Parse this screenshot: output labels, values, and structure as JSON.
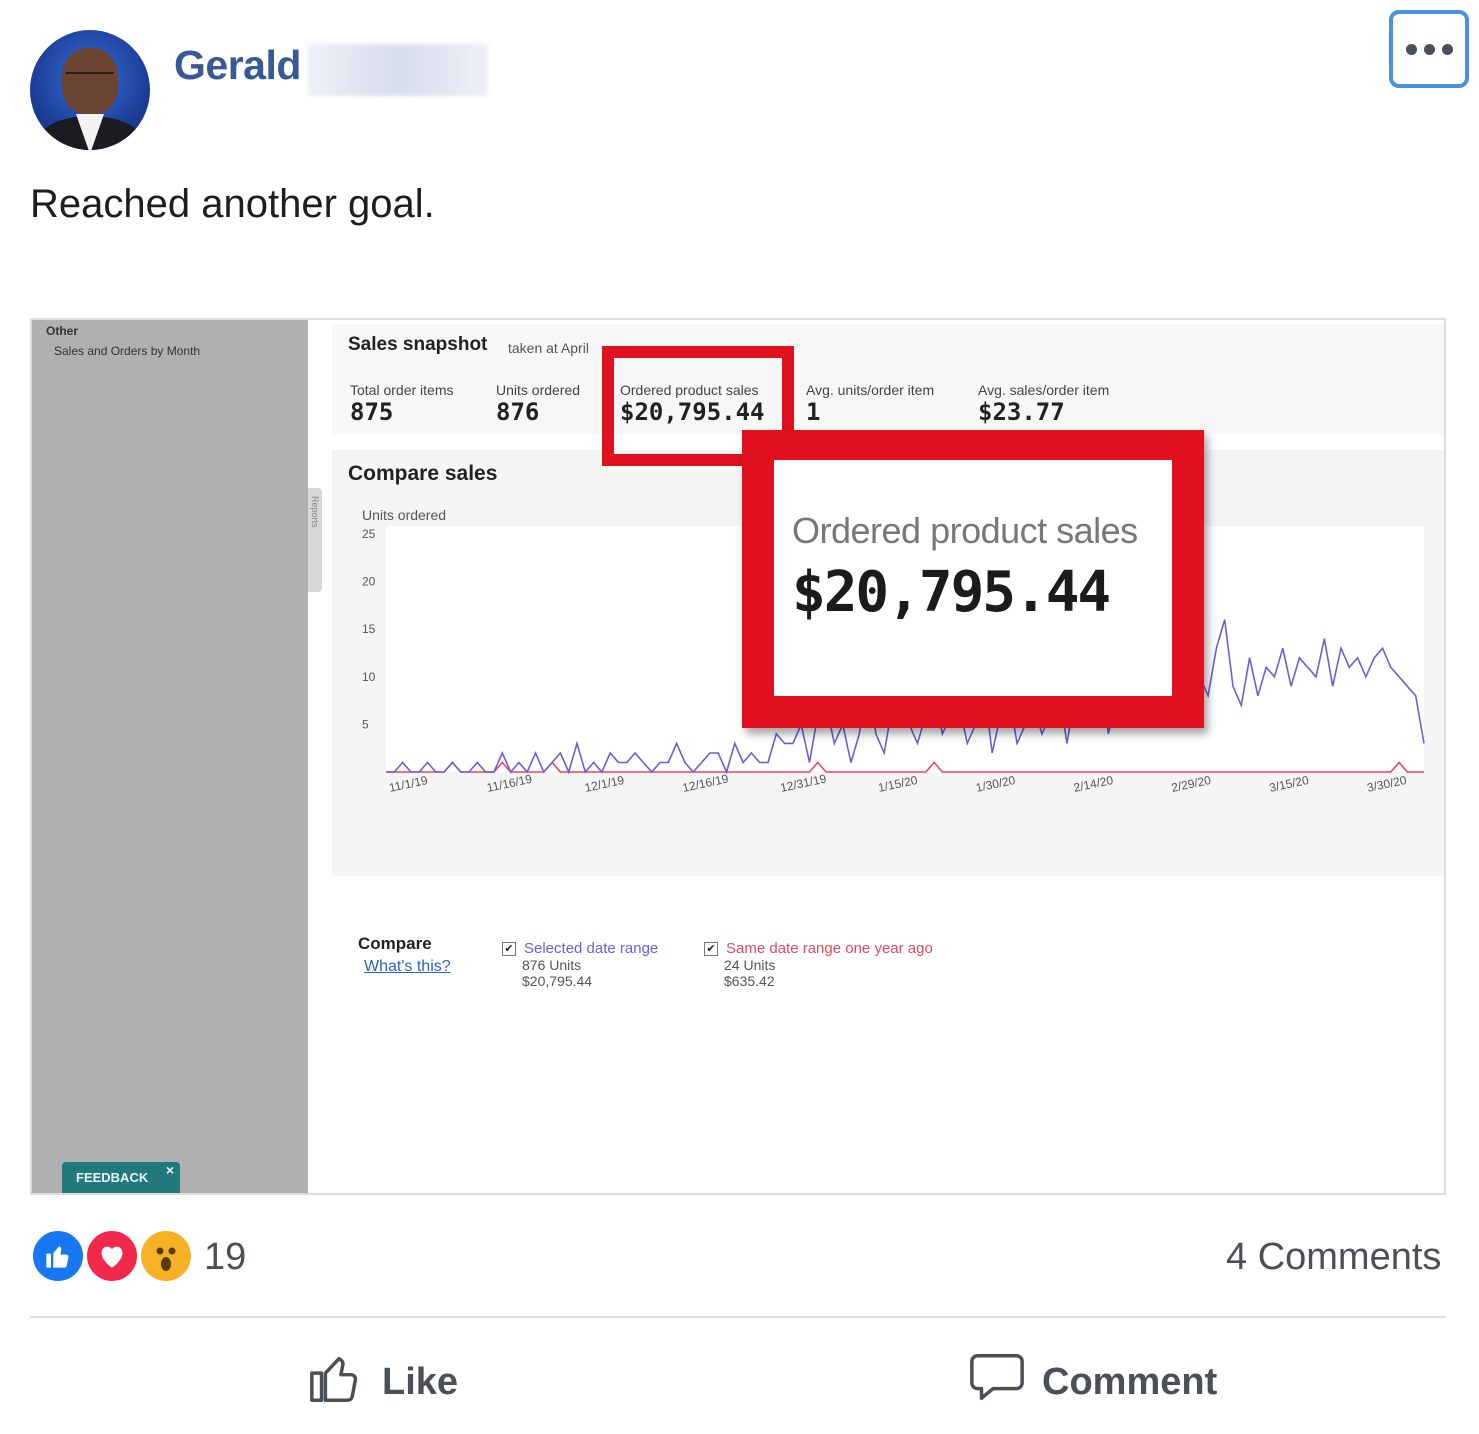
{
  "post": {
    "author": "Gerald",
    "text": "Reached another goal."
  },
  "screenshot": {
    "sidebar": {
      "section": "Other",
      "item": "Sales and Orders by Month",
      "feedback": "FEEDBACK",
      "feedback_close": "×",
      "reports_tab": "Reports"
    },
    "snapshot": {
      "title": "Sales snapshot",
      "taken": "taken at April",
      "metrics": [
        {
          "label": "Total order items",
          "value": "875"
        },
        {
          "label": "Units ordered",
          "value": "876"
        },
        {
          "label": "Ordered product sales",
          "value": "$20,795.44"
        },
        {
          "label": "Avg. units/order item",
          "value": "1"
        },
        {
          "label": "Avg. sales/order item",
          "value": "$23.77"
        }
      ]
    },
    "compare": {
      "title": "Compare sales",
      "compare_label": "Compare",
      "whats_this": "What's this?",
      "selected": {
        "label": "Selected date range",
        "units": "876 Units",
        "sales": "$20,795.44",
        "check": "✔"
      },
      "prior": {
        "label": "Same date range one year ago",
        "units": "24 Units",
        "sales": "$635.42",
        "check": "✔"
      }
    },
    "zoom": {
      "label": "Ordered product sales",
      "value": "$20,795.44"
    },
    "colors": {
      "selected": "#6a5fd8",
      "prior": "#e8485a",
      "highlight": "#e0101e"
    }
  },
  "chart_data": {
    "type": "line",
    "ylabel": "Units ordered",
    "ylim": [
      0,
      25
    ],
    "yticks": [
      "25",
      "20",
      "15",
      "10",
      "5"
    ],
    "xticks": [
      "11/1/19",
      "11/16/19",
      "12/1/19",
      "12/16/19",
      "12/31/19",
      "1/15/20",
      "1/30/20",
      "2/14/20",
      "2/29/20",
      "3/15/20",
      "3/30/20"
    ],
    "series": [
      {
        "name": "Selected date range",
        "values": [
          0,
          0,
          1,
          0,
          0,
          1,
          0,
          0,
          1,
          0,
          0,
          1,
          0,
          0,
          2,
          0,
          1,
          0,
          2,
          0,
          1,
          2,
          0,
          3,
          0,
          1,
          0,
          2,
          1,
          1,
          2,
          1,
          0,
          1,
          1,
          3,
          1,
          0,
          1,
          2,
          2,
          0,
          3,
          1,
          2,
          1,
          1,
          4,
          3,
          3,
          5,
          1,
          6,
          7,
          3,
          5,
          1,
          4,
          10,
          4,
          2,
          7,
          8,
          5,
          3,
          6,
          8,
          4,
          6,
          7,
          3,
          5,
          9,
          2,
          6,
          8,
          3,
          5,
          7,
          4,
          6,
          9,
          3,
          8,
          5,
          7,
          10,
          4,
          8,
          6,
          9,
          5,
          7,
          8,
          11,
          6,
          9,
          7,
          10,
          8,
          13,
          16,
          9,
          7,
          12,
          8,
          11,
          10,
          13,
          9,
          12,
          11,
          10,
          14,
          9,
          13,
          11,
          12,
          10,
          12,
          13,
          11,
          10,
          9,
          8,
          3
        ]
      },
      {
        "name": "Same date range one year ago",
        "values": [
          0,
          0,
          0,
          0,
          0,
          0,
          0,
          0,
          1,
          0,
          0,
          0,
          0,
          0,
          1,
          0,
          0,
          0,
          0,
          0,
          1,
          0,
          0,
          0,
          0,
          0,
          0,
          0,
          0,
          0,
          0,
          0,
          0,
          0,
          0,
          0,
          0,
          0,
          0,
          0,
          0,
          0,
          0,
          0,
          0,
          0,
          0,
          0,
          0,
          0,
          0,
          0,
          1,
          0,
          0,
          0,
          0,
          0,
          0,
          0,
          0,
          0,
          0,
          0,
          0,
          0,
          1,
          0,
          0,
          0,
          0,
          0,
          0,
          0,
          0,
          0,
          0,
          0,
          0,
          0,
          0,
          0,
          0,
          0,
          0,
          0,
          0,
          0,
          0,
          0,
          0,
          0,
          0,
          0,
          0,
          0,
          0,
          0,
          0,
          0,
          0,
          0,
          0,
          0,
          0,
          0,
          0,
          0,
          0,
          0,
          0,
          0,
          0,
          0,
          0,
          0,
          0,
          0,
          0,
          0,
          0,
          0,
          1,
          0,
          0,
          0
        ]
      }
    ],
    "grid": false
  },
  "footer": {
    "reaction_count": "19",
    "comments_count": "4 Comments",
    "like_label": "Like",
    "comment_label": "Comment"
  }
}
